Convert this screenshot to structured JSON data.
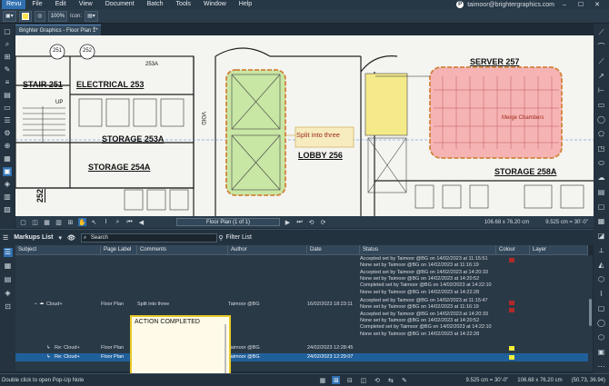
{
  "menu": [
    "Revu",
    "File",
    "Edit",
    "View",
    "Document",
    "Batch",
    "Tools",
    "Window",
    "Help"
  ],
  "user": {
    "email": "taimoor@brightergraphics.com",
    "avatar_letter": "P"
  },
  "window_controls": [
    "–",
    "☐",
    "✕"
  ],
  "toolbar": {
    "zoom": "100%",
    "icon_label": "Icon:",
    "accent_color": "#ffe34d"
  },
  "doc_tab": {
    "label": "Brighter Graphics - Floor Plan 1*",
    "close": "×"
  },
  "drawing": {
    "rooms": [
      {
        "label": "STAIR  251"
      },
      {
        "label": "ELECTRICAL  253"
      },
      {
        "label": "STORAGE  253A"
      },
      {
        "label": "STORAGE  254A"
      },
      {
        "label": "LOBBY  256"
      },
      {
        "label": "SERVER  257"
      },
      {
        "label": "STORAGE  258A"
      },
      {
        "label": "252"
      }
    ],
    "tags": [
      "251",
      "252",
      "253A",
      "UP",
      "VOID"
    ],
    "callouts": [
      "Split into three",
      "Merge Chambers"
    ],
    "cloud_green": "#c8e6a4",
    "cloud_red": "#f6b3b3",
    "cloud_yellow": "#f5ea8a"
  },
  "navbar": {
    "page": "Floor Plan (1 of 1)",
    "size": "106.68 x 76.20 cm",
    "scale": "9.525 cm = 30'-0\""
  },
  "markups_list": {
    "title": "Markups List",
    "search_placeholder": "Search",
    "filter_label": "Filter List",
    "columns": [
      "Subject",
      "Page Label",
      "Comments",
      "Author",
      "Date",
      "Status",
      "Colour",
      "Layer"
    ],
    "rows": [
      {
        "subject": "Cloud+",
        "page": "Floor Plan",
        "comment": "Split into three",
        "author": "Taimoor @BG",
        "date": "16/02/2023 18:23:11"
      },
      {
        "subject": "Re: Cloud+",
        "page": "Floor Plan",
        "comment": "",
        "author": "Taimoor @BG",
        "date": "24/02/2023 12:28:45"
      },
      {
        "subject": "Re: Cloud+",
        "page": "Floor Plan",
        "comment": "",
        "author": "Taimoor @BG",
        "date": "24/02/2023 12:29:07"
      }
    ],
    "status_lines_top": [
      "Accepted set by Taimoor @BG on 14/02/2023 at 11:15:51",
      "None set by Taimoor @BG on 14/02/2023 at 11:16:19",
      "Accepted set by Taimoor @BG on 14/02/2023 at 14:20:33",
      "None set by Taimoor @BG on 14/02/2023 at 14:20:52",
      "Completed set by Taimoor @BG on 14/02/2023 at 14:22:10",
      "None set by Taimoor @BG on 14/02/2023 at 14:22:28"
    ],
    "status_lines_mid": [
      "Accepted set by Taimoor @BG on 14/02/2023 at 11:15:47",
      "None set by Taimoor @BG on 14/02/2023 at 11:16:19",
      "Accepted set by Taimoor @BG on 14/02/2023 at 14:20:33",
      "None set by Taimoor @BG on 14/02/2023 at 14:20:52",
      "Completed set by Taimoor @BG on 14/02/2023 at 14:22:10",
      "None set by Taimoor @BG on 14/02/2023 at 14:22:28"
    ],
    "colour_red": "#b02a2a",
    "colour_yellow": "#f1ee3a"
  },
  "note": {
    "text": "ACTION COMPLETED"
  },
  "statusbar": {
    "hint": "Double click to open Pop-Up Note",
    "scale": "9.525 cm = 30'-0\"",
    "size": "106.68 x 76.20 cm",
    "coords": "(50.73, 36.94)"
  }
}
